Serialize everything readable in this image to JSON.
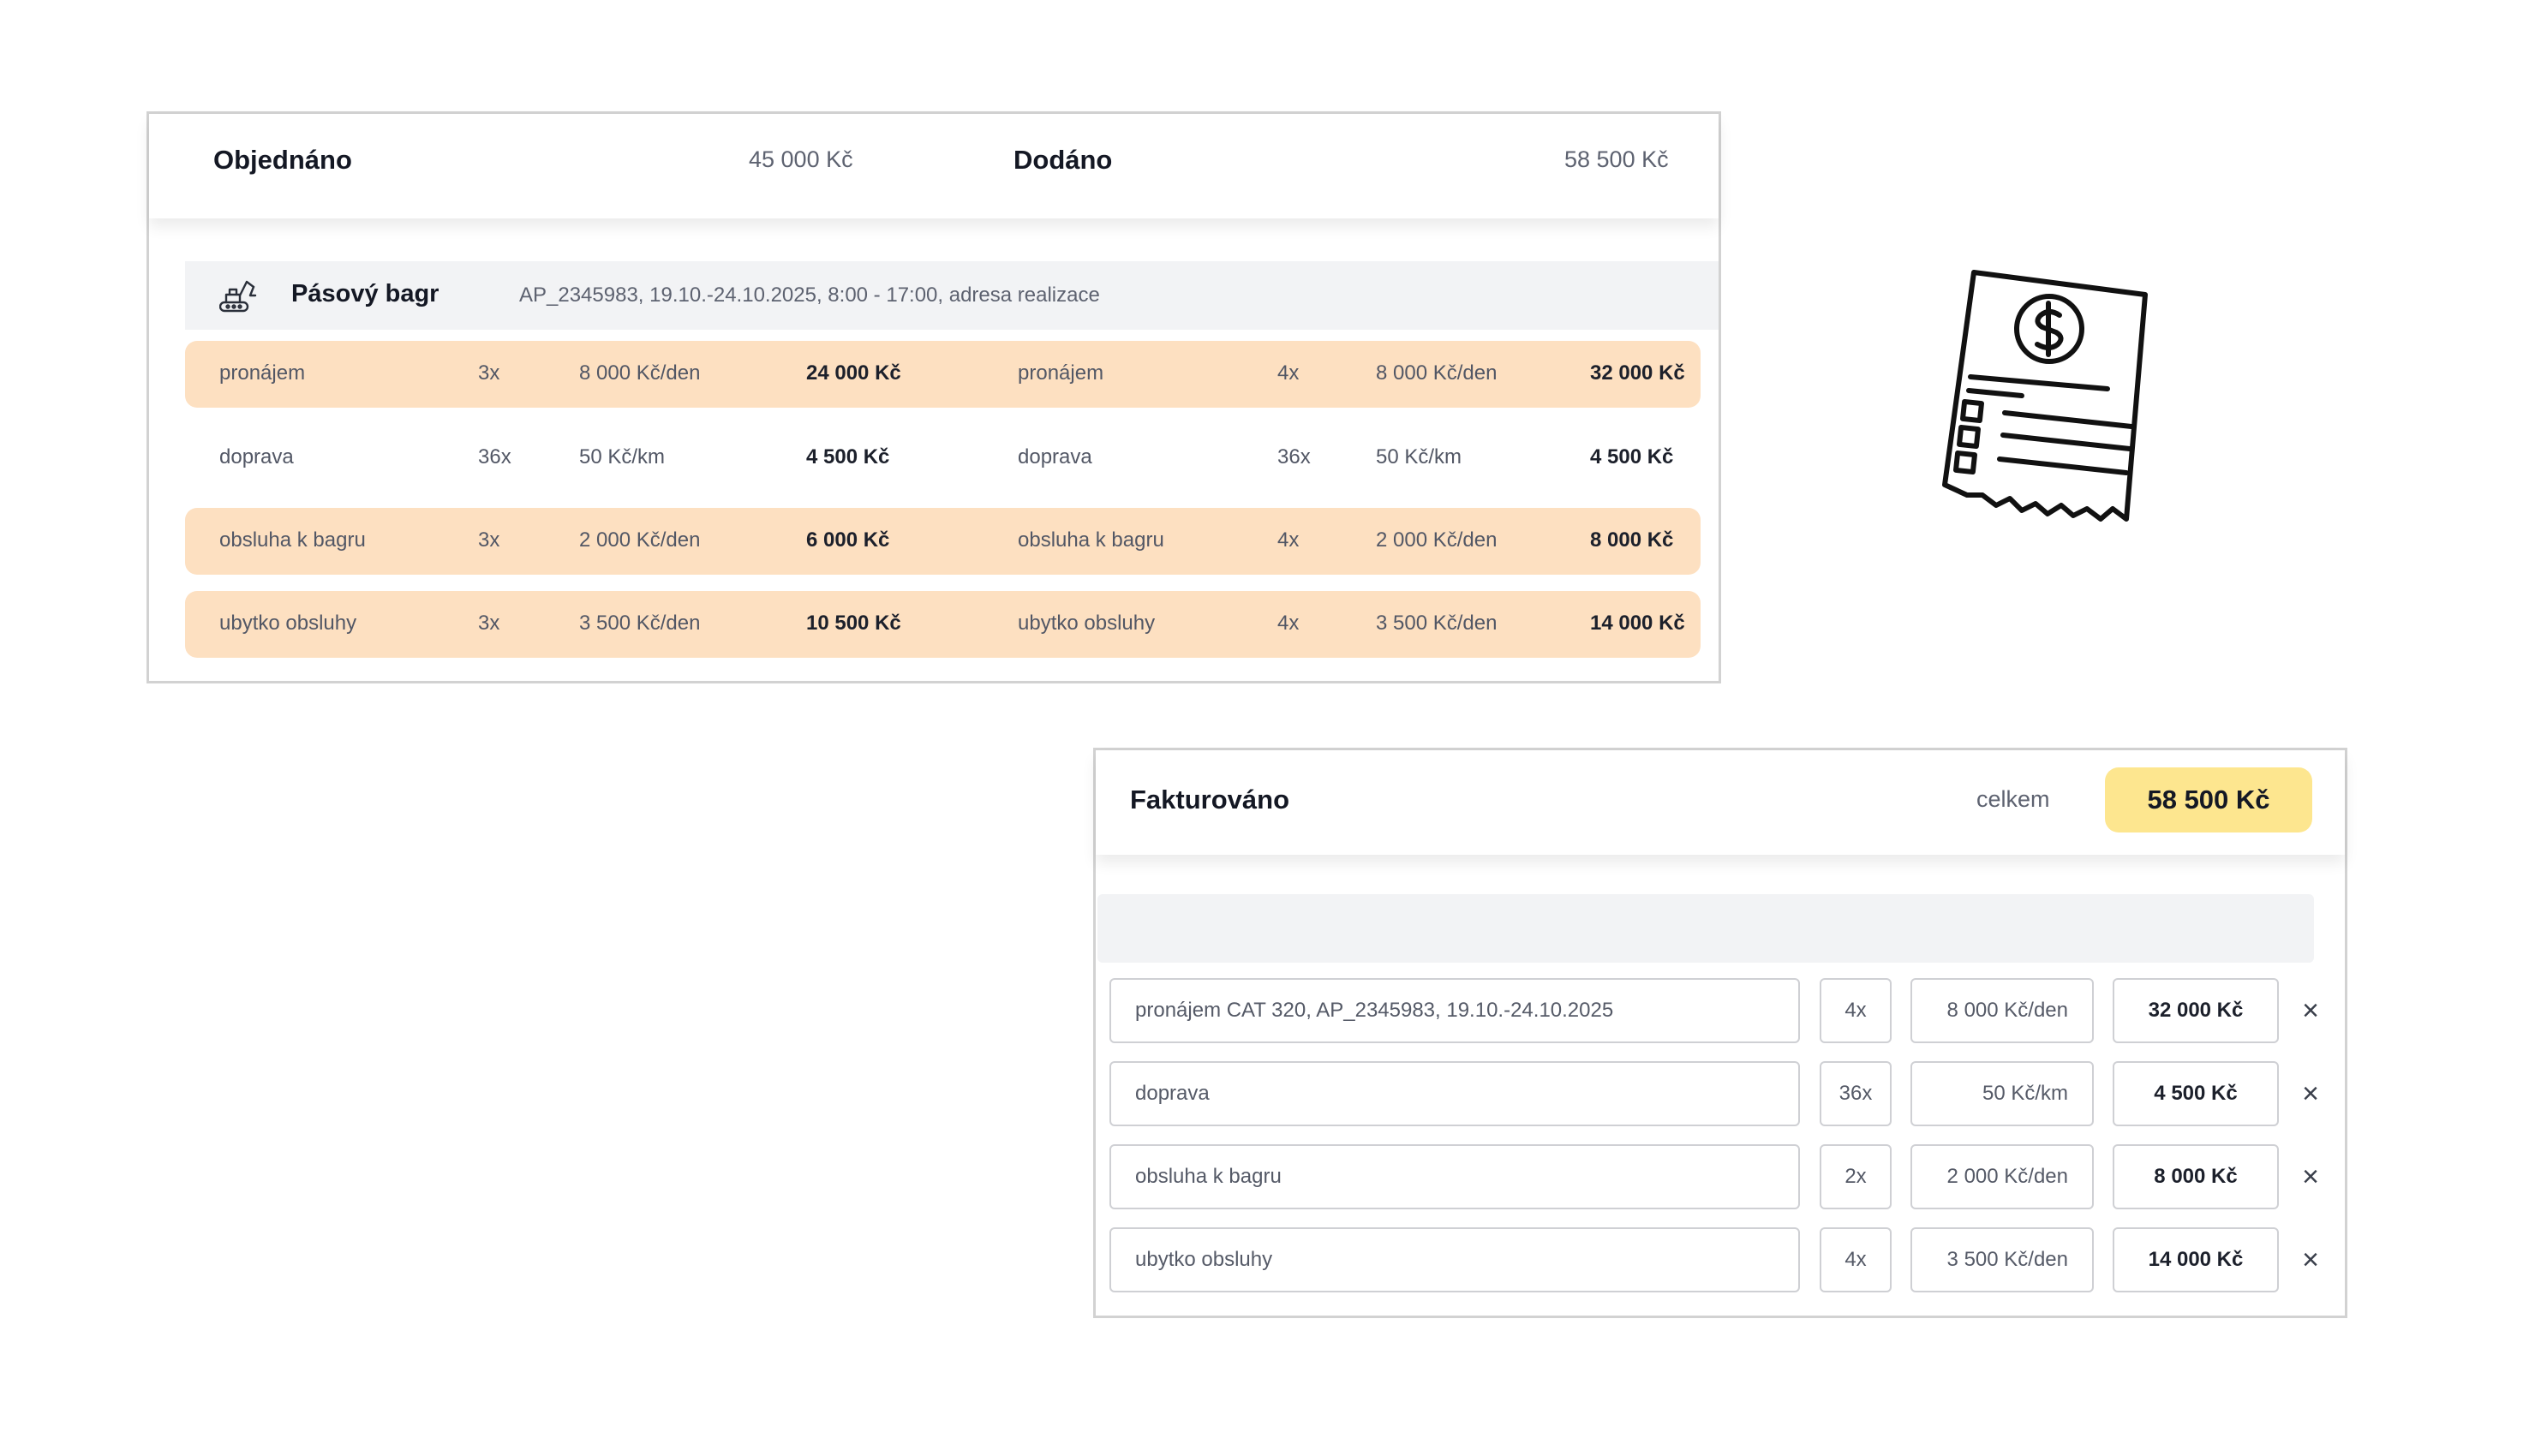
{
  "ordered": {
    "title": "Objednáno",
    "total": "45 000 Kč",
    "delivered_title": "Dodáno",
    "delivered_total": "58 500 Kč"
  },
  "machine": {
    "name": "Pásový bagr",
    "details": "AP_2345983, 19.10.-24.10.2025, 8:00 - 17:00, adresa realizace",
    "icon": "excavator-icon"
  },
  "order_rows": [
    {
      "ord_name": "pronájem",
      "ord_qty": "3x",
      "ord_price": "8 000 Kč/den",
      "ord_total": "24 000 Kč",
      "del_name": "pronájem",
      "del_qty": "4x",
      "del_price": "8 000 Kč/den",
      "del_total": "32 000 Kč",
      "highlight": true
    },
    {
      "ord_name": "doprava",
      "ord_qty": "36x",
      "ord_price": "50 Kč/km",
      "ord_total": "4 500 Kč",
      "del_name": "doprava",
      "del_qty": "36x",
      "del_price": "50 Kč/km",
      "del_total": "4 500 Kč",
      "highlight": false
    },
    {
      "ord_name": "obsluha k bagru",
      "ord_qty": "3x",
      "ord_price": "2 000 Kč/den",
      "ord_total": "6 000 Kč",
      "del_name": "obsluha k bagru",
      "del_qty": "4x",
      "del_price": "2 000 Kč/den",
      "del_total": "8 000 Kč",
      "highlight": true
    },
    {
      "ord_name": "ubytko obsluhy",
      "ord_qty": "3x",
      "ord_price": "3 500 Kč/den",
      "ord_total": "10 500 Kč",
      "del_name": "ubytko obsluhy",
      "del_qty": "4x",
      "del_price": "3 500 Kč/den",
      "del_total": "14 000 Kč",
      "highlight": true
    }
  ],
  "invoiced": {
    "title": "Fakturováno",
    "total_label": "celkem",
    "total": "58 500 Kč",
    "total_badge_color": "#fde68f",
    "rows": [
      {
        "name": "pronájem CAT 320, AP_2345983, 19.10.-24.10.2025",
        "qty": "4x",
        "price": "8 000 Kč/den",
        "total": "32 000 Kč"
      },
      {
        "name": "doprava",
        "qty": "36x",
        "price": "50 Kč/km",
        "total": "4 500 Kč"
      },
      {
        "name": "obsluha k bagru",
        "qty": "2x",
        "price": "2 000 Kč/den",
        "total": "8 000 Kč"
      },
      {
        "name": "ubytko obsluhy",
        "qty": "4x",
        "price": "3 500 Kč/den",
        "total": "14 000 Kč"
      }
    ],
    "remove_icon": "close-icon"
  },
  "illustration": {
    "icon": "receipt-dollar-icon"
  },
  "colors": {
    "highlight_row": "#fde0c1",
    "strip": "#f2f3f5",
    "border": "#d2d2d2"
  }
}
